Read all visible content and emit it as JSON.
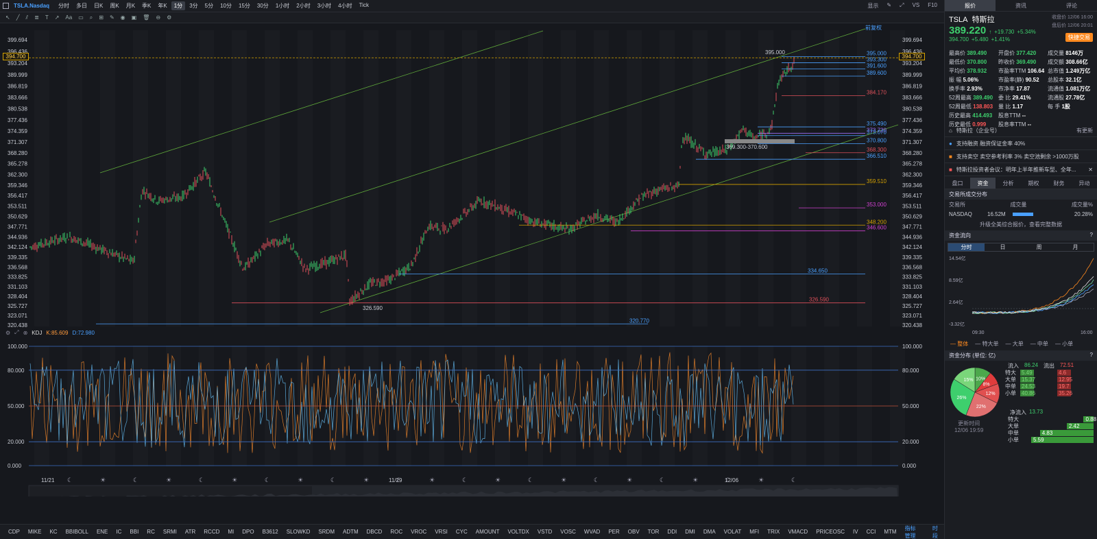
{
  "header": {
    "symbol": "TSLA.Nasdaq",
    "timeframes": [
      "分时",
      "多日",
      "日K",
      "周K",
      "月K",
      "季K",
      "年K",
      "1分",
      "3分",
      "5分",
      "10分",
      "15分",
      "30分",
      "1小时",
      "2小时",
      "3小时",
      "4小时",
      "Tick"
    ],
    "active_tf": "1分",
    "right_items": [
      "显示",
      "VS",
      "F10"
    ]
  },
  "price_axis": [
    "399.694",
    "396.436",
    "393.204",
    "389.999",
    "386.819",
    "383.666",
    "380.538",
    "377.436",
    "374.359",
    "371.307",
    "368.280",
    "365.278",
    "362.300",
    "359.346",
    "356.417",
    "353.511",
    "350.629",
    "347.771",
    "344.936",
    "342.124",
    "339.335",
    "336.568",
    "333.825",
    "331.103",
    "328.404",
    "325.727",
    "323.071",
    "320.438"
  ],
  "current_price_tag": "394.700",
  "fq_label": "前复权",
  "levels": [
    "395.000",
    "393.300",
    "391.600",
    "389.600",
    "384.170",
    "375.490",
    "373.720",
    "373.070",
    "370.800",
    "368.300",
    "366.510",
    "359.510",
    "353.000",
    "348.200",
    "346.600",
    "334.650",
    "326.590",
    "320.770"
  ],
  "range_label": "369.300-370.600",
  "low_label": "326.590",
  "kdj": {
    "name": "KDJ",
    "k": "K:85.609",
    "d": "D:72.980",
    "axis": [
      "100.000",
      "80.000",
      "50.000",
      "20.000",
      "0.000"
    ]
  },
  "dates": [
    "11/21",
    "11/29",
    "12/06"
  ],
  "indicators": [
    "CDP",
    "MIKE",
    "KC",
    "BBIBOLL",
    "ENE",
    "IC",
    "BBI",
    "RC",
    "SRMI",
    "ATR",
    "RCCD",
    "MI",
    "DPO",
    "B3612",
    "SLOWKD",
    "SRDM",
    "ADTM",
    "DBCD",
    "ROC",
    "VROC",
    "VRSI",
    "CYC",
    "AMOUNT",
    "VOLTDX",
    "VSTD",
    "VOSC",
    "WVAD",
    "PER",
    "OBV",
    "TOR",
    "DDI",
    "DMI",
    "DMA",
    "VOLAT",
    "MFI",
    "TRIX",
    "VMACD",
    "PRICEOSC",
    "IV",
    "CCI",
    "MTM"
  ],
  "indicator_manage": "指标管理",
  "timing": "时段",
  "right": {
    "tabs": [
      "报价",
      "资讯",
      "评论"
    ],
    "ticker": "TSLA",
    "name": "特斯拉",
    "price": "389.220",
    "change": "+19.730",
    "pct": "+5.34%",
    "close_time": "收盘价 12/06 16:00",
    "after_price": "394.700",
    "after_change": "+5.480",
    "after_pct": "+1.41%",
    "after_time": "盘后价 12/06 20:01",
    "quick_trade": "快捷交易",
    "quote": [
      [
        "最高价",
        "389.490",
        "开盘价",
        "377.420",
        "成交量",
        "8146万"
      ],
      [
        "最低价",
        "370.800",
        "昨收价",
        "369.490",
        "成交额",
        "308.66亿"
      ],
      [
        "平均价",
        "378.932",
        "市盈率TTM",
        "106.64",
        "总市值",
        "1.249万亿"
      ],
      [
        "振 幅",
        "5.06%",
        "市盈率(静)",
        "90.52",
        "总股本",
        "32.1亿"
      ],
      [
        "换手率",
        "2.93%",
        "市净率",
        "17.87",
        "流通值",
        "1.081万亿"
      ],
      [
        "52周最高",
        "389.490",
        "委 比",
        "29.41%",
        "流通股",
        "27.78亿"
      ],
      [
        "52周最低",
        "138.803",
        "量 比",
        "1.17",
        "每 手",
        "1股"
      ],
      [
        "历史最高",
        "414.493",
        "股息TTM",
        "--",
        "",
        ""
      ],
      [
        "历史最低",
        "0.999",
        "股息率TTM",
        "--",
        "",
        ""
      ]
    ],
    "company": "特斯拉（企业号）",
    "company_update": "有更新",
    "margin": "支持融资   融资保证金率 40%",
    "short": "支持卖空   卖空参考利率 3%   卖空池剩余 >1000万股",
    "news": "特斯拉投资者会议：明年上半年推新车型、全年...",
    "sub_tabs": [
      "盘口",
      "资金",
      "分析",
      "期权",
      "财务",
      "异动"
    ],
    "exchange_title": "交易所成交分布",
    "exchange_cols": [
      "交易所",
      "成交量",
      "成交量%"
    ],
    "exchange_row": [
      "NASDAQ",
      "16.52M",
      "20.28%"
    ],
    "upgrade": "升级全美综合报价，查看完整数据",
    "flow_title": "资金流向",
    "flow_tabs": [
      "分时",
      "日",
      "周",
      "月"
    ],
    "flow_axis": [
      "14.54亿",
      "8.59亿",
      "2.64亿",
      "-3.32亿"
    ],
    "flow_time": [
      "09:30",
      "16:00"
    ],
    "flow_legend": [
      "整体",
      "特大单",
      "大单",
      "中单",
      "小单"
    ],
    "dist_title": "资金分布 (单位: 亿)",
    "inflow_label": "流入",
    "inflow": "86.24",
    "outflow_label": "流出",
    "outflow": "72.51",
    "dist_rows": [
      [
        "特大",
        "5.49",
        "4.6"
      ],
      [
        "大单",
        "15.37",
        "12.95"
      ],
      [
        "中单",
        "24.53",
        "19.7"
      ],
      [
        "小单",
        "40.86",
        "35.26"
      ]
    ],
    "pie_labels": [
      "10%",
      "8%",
      "12%",
      "15%",
      "22%",
      "26%"
    ],
    "net_label": "净流入",
    "net": "13.73",
    "update_label": "更新时间",
    "update_time": "12/06 19:59",
    "net_rows": [
      [
        "特大",
        "0.88"
      ],
      [
        "大单",
        "2.42"
      ],
      [
        "中单",
        "4.83"
      ],
      [
        "小单",
        "5.59"
      ]
    ]
  }
}
